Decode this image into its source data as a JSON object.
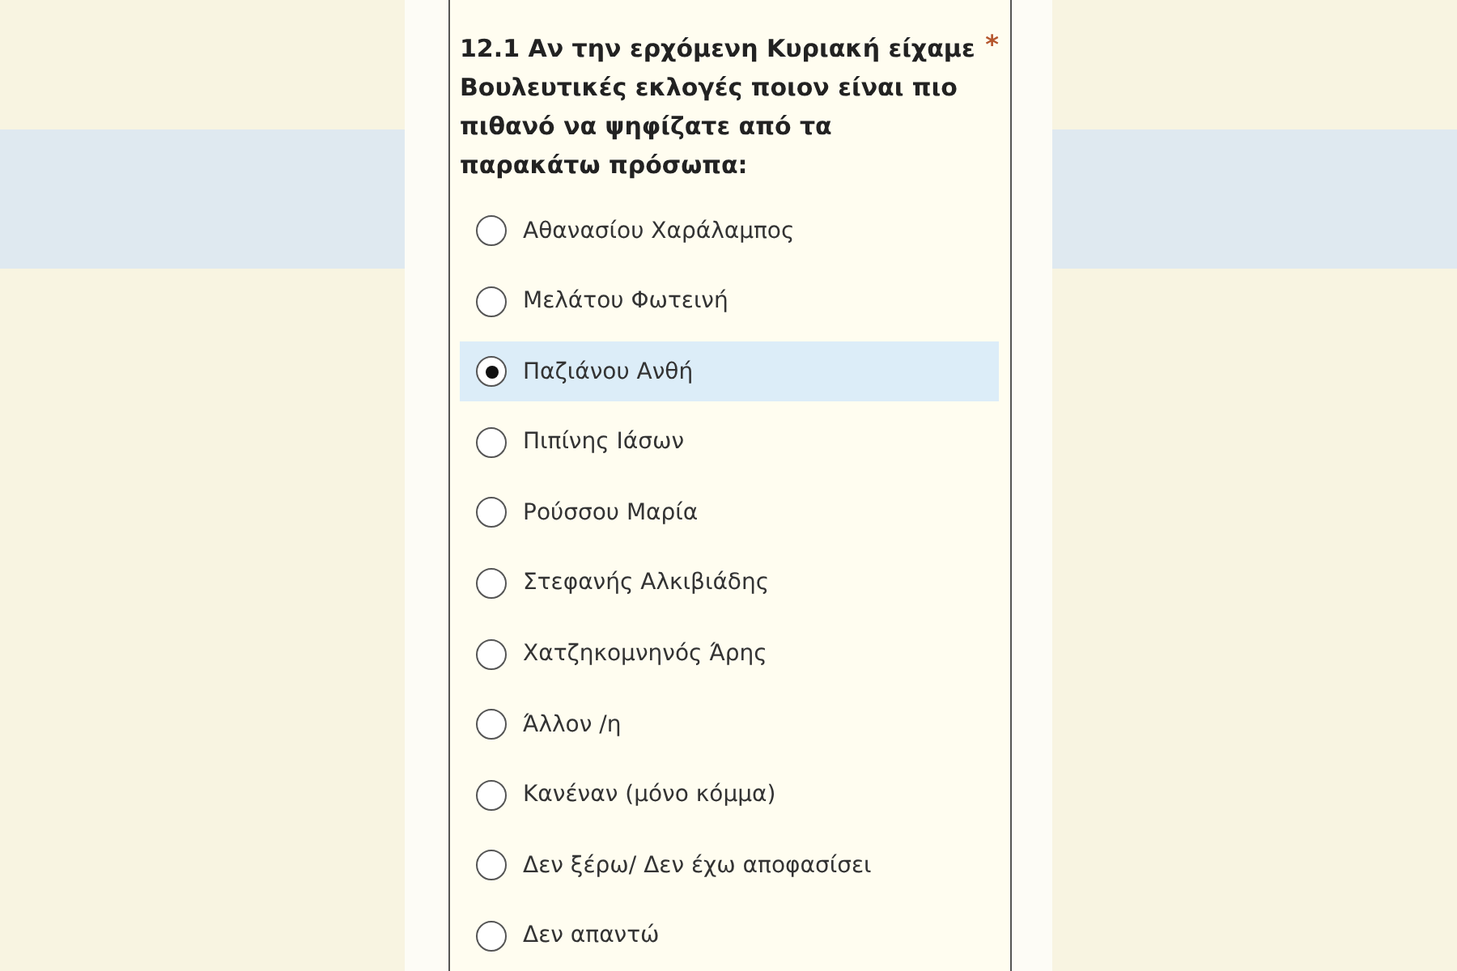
{
  "question": {
    "text": "12.1 Αν την ερχόμενη Κυριακή είχαμε Βουλευτικές εκλογές ποιον είναι πιο πιθανό να ψηφίζατε από τα παρακάτω πρόσωπα:",
    "required_mark": "*"
  },
  "options": [
    {
      "label": "Αθανασίου Χαράλαμπος",
      "selected": false
    },
    {
      "label": "Μελάτου Φωτεινή",
      "selected": false
    },
    {
      "label": "Παζιάνου Ανθή",
      "selected": true
    },
    {
      "label": "Πιπίνης Ιάσων",
      "selected": false
    },
    {
      "label": "Ρούσσου Μαρία",
      "selected": false
    },
    {
      "label": "Στεφανής Αλκιβιάδης",
      "selected": false
    },
    {
      "label": "Χατζηκομνηνός Άρης",
      "selected": false
    },
    {
      "label": "Άλλον /η",
      "selected": false
    },
    {
      "label": "Κανέναν (μόνο κόμμα)",
      "selected": false
    },
    {
      "label": "Δεν ξέρω/ Δεν έχω αποφασίσει",
      "selected": false
    },
    {
      "label": "Δεν απαντώ",
      "selected": false
    }
  ]
}
